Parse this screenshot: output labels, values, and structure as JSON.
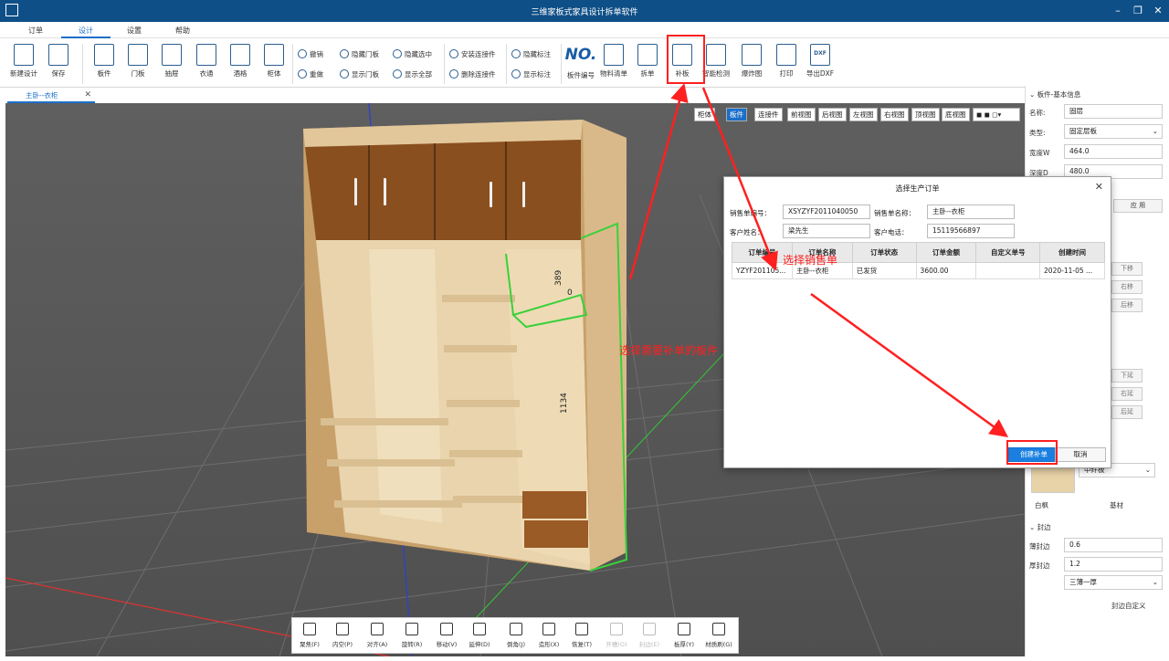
{
  "window": {
    "title": "三维家板式家具设计拆单软件"
  },
  "menu": {
    "tabs": [
      "订单",
      "设计",
      "设置",
      "帮助"
    ]
  },
  "ribbon": {
    "big": [
      {
        "label": "新建设计",
        "icon": "new-design-icon"
      },
      {
        "label": "保存",
        "icon": "save-icon"
      },
      {
        "label": "板件",
        "icon": "panel-icon"
      },
      {
        "label": "门板",
        "icon": "door-panel-icon"
      },
      {
        "label": "抽屉",
        "icon": "drawer-icon"
      },
      {
        "label": "衣通",
        "icon": "clothes-rail-icon"
      },
      {
        "label": "酒格",
        "icon": "wine-rack-icon"
      },
      {
        "label": "柜体",
        "icon": "cabinet-icon"
      }
    ],
    "small": [
      {
        "label": "撤销",
        "icon": "undo-icon"
      },
      {
        "label": "重做",
        "icon": "redo-icon"
      },
      {
        "label": "隐藏门板",
        "icon": "hide-door-icon"
      },
      {
        "label": "显示门板",
        "icon": "show-door-icon"
      },
      {
        "label": "隐藏选中",
        "icon": "hide-selected-icon"
      },
      {
        "label": "显示全部",
        "icon": "show-all-icon"
      },
      {
        "label": "安装连接件",
        "icon": "install-connector-icon"
      },
      {
        "label": "删除连接件",
        "icon": "delete-connector-icon"
      },
      {
        "label": "隐藏标注",
        "icon": "hide-dimension-icon"
      },
      {
        "label": "显示标注",
        "icon": "show-dimension-icon"
      }
    ],
    "right": [
      {
        "label": "板件编号",
        "icon": "panel-number-icon"
      },
      {
        "label": "物料清单",
        "icon": "bom-icon"
      },
      {
        "label": "拆单",
        "icon": "split-order-icon"
      },
      {
        "label": "补板",
        "icon": "supplement-panel-icon"
      },
      {
        "label": "智能检测",
        "icon": "smart-check-icon"
      },
      {
        "label": "爆炸图",
        "icon": "explode-view-icon"
      },
      {
        "label": "打印",
        "icon": "print-icon"
      },
      {
        "label": "导出DXF",
        "icon": "export-dxf-icon"
      }
    ],
    "no_text": "NO.",
    "dxf_text": "DXF"
  },
  "doc_tab": {
    "label": "主卧--衣柜"
  },
  "view_toolbar": [
    "柜体",
    "板件",
    "连接件",
    "前视图",
    "后视图",
    "左视图",
    "右视图",
    "顶视图",
    "底视图"
  ],
  "model": {
    "dim_top": "389",
    "dim_mid": "1134",
    "dim_zero": "0"
  },
  "bottom_toolbar": [
    {
      "label": "聚焦(F)",
      "disabled": false
    },
    {
      "label": "内空(P)",
      "disabled": false
    },
    {
      "label": "对齐(A)",
      "disabled": false
    },
    {
      "label": "旋转(R)",
      "disabled": false
    },
    {
      "label": "移动(V)",
      "disabled": false
    },
    {
      "label": "延伸(D)",
      "disabled": false
    },
    {
      "label": "倒角(J)",
      "disabled": false
    },
    {
      "label": "造形(X)",
      "disabled": false
    },
    {
      "label": "恢复(T)",
      "disabled": false
    },
    {
      "label": "开槽(O)",
      "disabled": true
    },
    {
      "label": "封边(E)",
      "disabled": true
    },
    {
      "label": "板厚(Y)",
      "disabled": false
    },
    {
      "label": "材质刷(G)",
      "disabled": false
    }
  ],
  "right_panel": {
    "section_basic": "板件-基本信息",
    "name_label": "名称:",
    "name_value": "固层",
    "type_label": "类型:",
    "type_value": "固定层板",
    "width_label": "宽度W",
    "width_value": "464.0",
    "depth_label": "深度D",
    "depth_value": "480.0",
    "apply": "应 用",
    "move_buttons": [
      "下移",
      "右移",
      "后移"
    ],
    "extend_buttons": [
      "下延",
      "右延",
      "后延"
    ],
    "material_value": "中纤板",
    "material_name": "白枫",
    "base_material": "基材",
    "section_edge": "封边",
    "thin_label": "薄封边",
    "thin_value": "0.6",
    "thick_label": "厚封边",
    "thick_value": "1.2",
    "edge_mode": "三薄一厚",
    "custom_edge": "封边自定义"
  },
  "dialog": {
    "title": "选择生产订单",
    "sales_no_label": "销售单编号：",
    "sales_no": "XSYZYF2011040050",
    "sales_name_label": "销售单名称：",
    "sales_name": "主卧--衣柜",
    "customer_label": "客户姓名：",
    "customer": "梁先生",
    "phone_label": "客户电话：",
    "phone": "15119566897",
    "columns": [
      "订单编号",
      "订单名称",
      "订单状态",
      "订单金额",
      "自定义单号",
      "创建时间"
    ],
    "rows": [
      [
        "YZYF201105...",
        "主卧--衣柜",
        "已发货",
        "3600.00",
        "",
        "2020-11-05 ..."
      ]
    ],
    "create_btn": "创建补单",
    "cancel_btn": "取消"
  },
  "annotations": {
    "select_sales": "选择销售单",
    "select_panel": "选择需要补单的板件"
  },
  "colors": {
    "accent": "#1a6fc9",
    "titlebar": "#0f4f87",
    "annotation": "#ff2020",
    "highlight": "#39d13a"
  }
}
